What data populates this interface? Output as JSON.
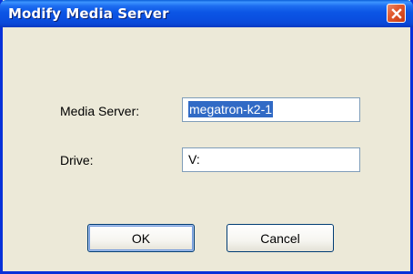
{
  "window": {
    "title": "Modify Media Server"
  },
  "titlebar": {
    "close_icon": "close-icon"
  },
  "form": {
    "media_server": {
      "label": "Media Server:",
      "value": "megatron-k2-1"
    },
    "drive": {
      "label": "Drive:",
      "value": "V:"
    }
  },
  "buttons": {
    "ok_label": "OK",
    "cancel_label": "Cancel"
  },
  "colors": {
    "titlebar": "#0b55e5",
    "dialog_bg": "#ece9d8",
    "selection": "#316ac5",
    "close_button": "#e25a2f"
  }
}
